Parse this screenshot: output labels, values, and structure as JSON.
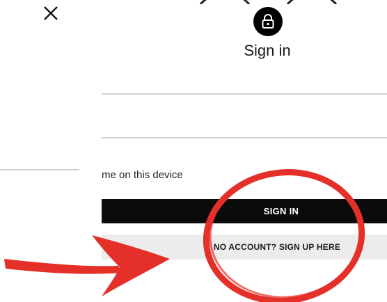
{
  "dialog": {
    "title": "Sign in",
    "close_icon": "close-icon",
    "lock_icon": "lock-icon"
  },
  "form": {
    "field_1_value": "",
    "field_2_value": "",
    "remember_label": "me on this device",
    "signin_label": "SIGN IN",
    "signup_label": "NO ACCOUNT? SIGN UP HERE"
  },
  "annotation": {
    "color": "#e5302a",
    "arrow_icon": "arrow-annotation",
    "circle_icon": "circle-annotation"
  },
  "colors": {
    "button_primary": "#0b0b0b",
    "button_secondary": "#ececec",
    "divider": "#d2d2d2"
  }
}
